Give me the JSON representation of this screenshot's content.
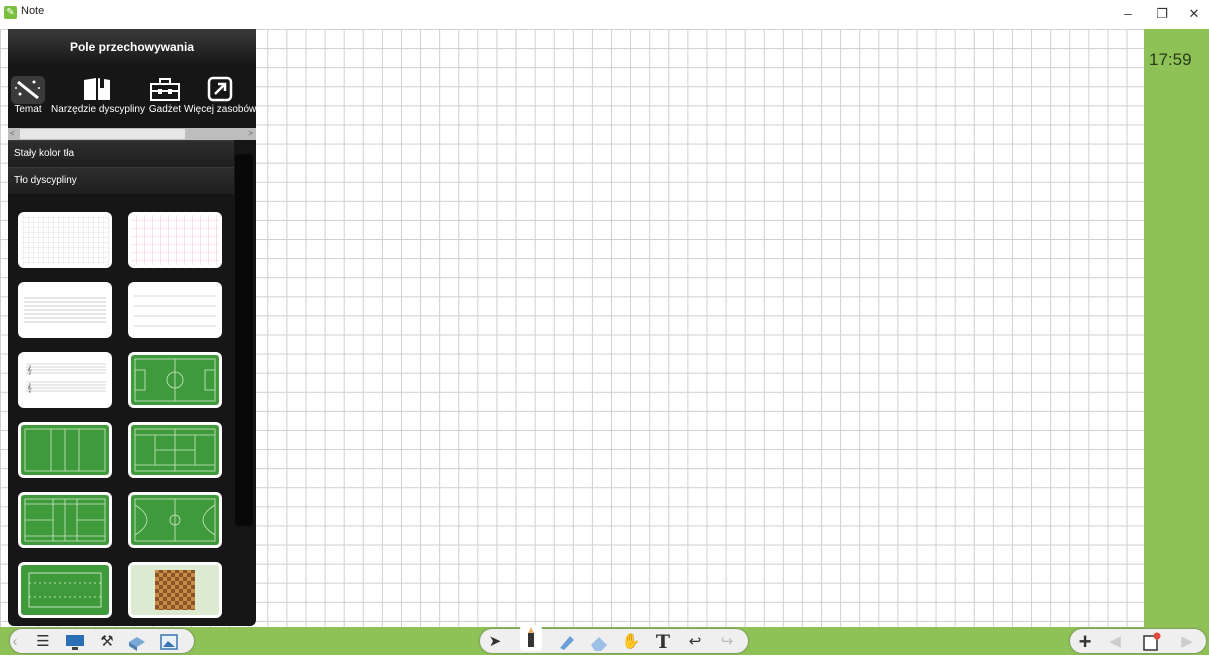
{
  "window": {
    "title": "Note",
    "minimize_glyph": "–",
    "maximize_glyph": "❐",
    "close_glyph": "✕"
  },
  "clock": {
    "time": "17:59"
  },
  "sidebar": {
    "title": "Pole przechowywania",
    "tools": [
      {
        "label": "Temat",
        "icon": "wand-icon"
      },
      {
        "label": "Narzędzie dyscypliny",
        "icon": "book-icon"
      },
      {
        "label": "Gadżet",
        "icon": "toolbox-icon"
      },
      {
        "label": "Więcej zasobów",
        "icon": "external-link-icon"
      }
    ],
    "sections": [
      {
        "label": "Stały kolor tła"
      },
      {
        "label": "Tło dyscypliny"
      }
    ]
  },
  "colors": {
    "accent_green": "#8ec156",
    "field_green": "#3f9a3b",
    "sidebar_bg": "#161616"
  }
}
